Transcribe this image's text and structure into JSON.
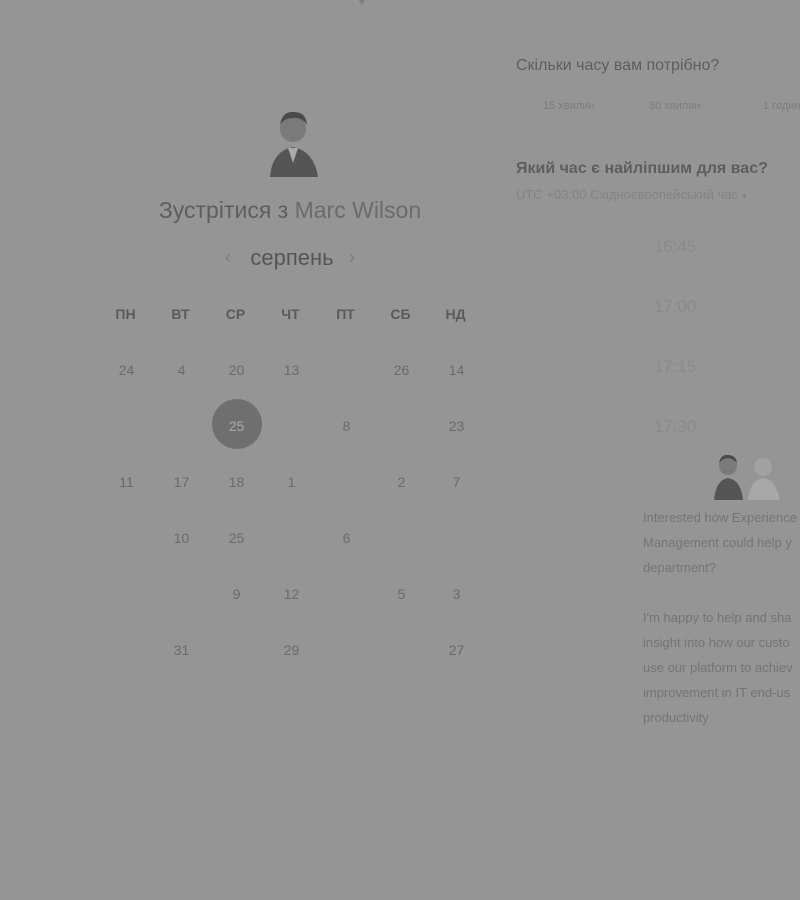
{
  "host": {
    "title_prefix": "Зустрітися з",
    "name": "Marc Wilson"
  },
  "calendar": {
    "month": "серпень",
    "prev_icon": "chevron-left-icon",
    "next_icon": "chevron-right-icon",
    "weekdays": [
      "ПН",
      "ВТ",
      "СР",
      "ЧТ",
      "ПТ",
      "СБ",
      "НД"
    ],
    "days": [
      "24",
      "4",
      "20",
      "13",
      "",
      "26",
      "14",
      "",
      "",
      "25",
      "",
      "8",
      "",
      "23",
      "11",
      "17",
      "18",
      "1",
      "",
      "2",
      "7",
      "",
      "10",
      "25",
      "",
      "6",
      "",
      "",
      "",
      "",
      "9",
      "12",
      "",
      "5",
      "3",
      "",
      "31",
      "",
      "29",
      "",
      "",
      "27"
    ],
    "selected_day": "25"
  },
  "duration": {
    "title": "Скільки часу вам потрібно?",
    "options": [
      "15 хвилин",
      "30 хвилин",
      "1 годин"
    ]
  },
  "time": {
    "title": "Який час є найліпшим для вас?",
    "timezone": "UTC +03:00 Східноєвропейський час",
    "slots": [
      "16:45",
      "17:00",
      "17:15",
      "17:30"
    ]
  },
  "bio": {
    "paragraph1": "Interested how Experience\nManagement could help y\ndepartment?",
    "paragraph2": "I'm happy to help and sha\ninsight into how our custo\nuse our platform to achiev\nimprovement in IT end-us\nproductivity"
  },
  "colors": {
    "overlay": "#959595",
    "selected_day": "#6f6f6f"
  }
}
